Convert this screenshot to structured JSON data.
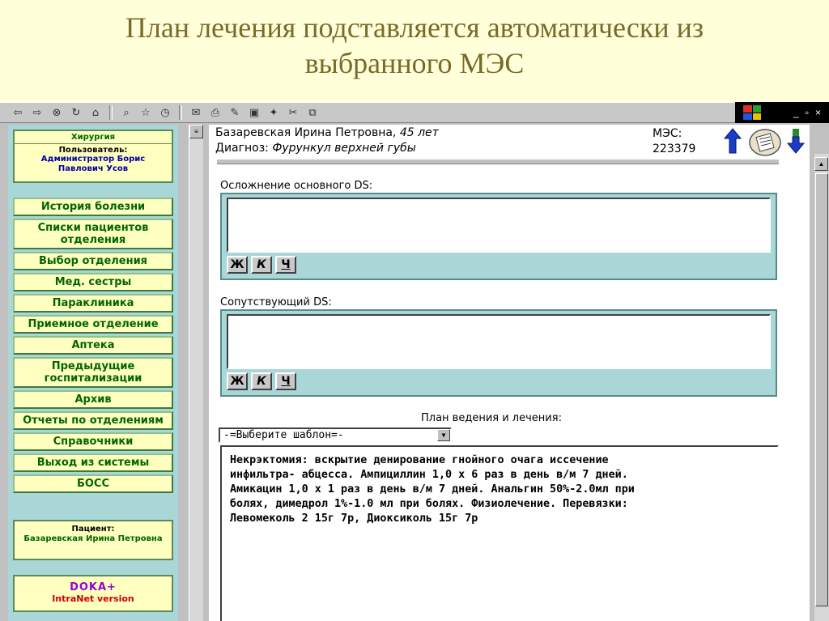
{
  "slide": {
    "title_line1": "План лечения подставляется автоматически из",
    "title_line2": "выбранного МЭС"
  },
  "toolbar": {
    "icons": [
      "back-icon",
      "forward-icon",
      "stop-icon",
      "refresh-icon",
      "home-icon",
      "search-icon",
      "favorites-icon",
      "history-icon",
      "mail-icon",
      "print-icon",
      "edit-icon",
      "discuss-icon",
      "messenger-icon",
      "cut-icon",
      "copy-icon"
    ]
  },
  "window_controls": {
    "minimize": "_",
    "restore": "▫",
    "close": "×"
  },
  "sidebar": {
    "dept": "Хирургия",
    "user_label": "Пользователь:",
    "user_name": "Администратор Борис Павлович Усов",
    "nav": [
      "История болезни",
      "Списки пациентов отделения",
      "Выбор отделения",
      "Мед. сестры",
      "Параклиника",
      "Приемное отделение",
      "Аптека",
      "Предыдущие госпитализации",
      "Архив",
      "Отчеты по отделениям",
      "Справочники",
      "Выход из системы",
      "БОСС"
    ],
    "patient_label": "Пациент:",
    "patient_name": "Базаревская Ирина Петровна",
    "brand": "DOKA+",
    "brand_sub": "IntraNet version"
  },
  "header": {
    "patient_name": "Базаревская Ирина Петровна,",
    "patient_age": " 45 лет",
    "diagnosis_label": "Диагноз: ",
    "diagnosis": "Фурункул верхней губы",
    "mes_label": "МЭС:",
    "mes_value": "223379"
  },
  "complication": {
    "label": "Осложнение основного DS:",
    "value": "",
    "buttons": [
      "Ж",
      "К",
      "Ч"
    ]
  },
  "concomitant": {
    "label": "Сопутствующий DS:",
    "value": "",
    "buttons": [
      "Ж",
      "К",
      "Ч"
    ]
  },
  "plan": {
    "label": "План ведения и лечения:",
    "template_select": "-=Выберите шаблон=-",
    "text": "Некрэктомия: вскрытие денирование гнойного очага иссечение\nинфильтра- абцесса. Ампициллин 1,0 х 6 раз в день в/м 7 дней.\nАмикацин 1,0 х 1 раз в день в/м 7 дней. Анальгин 50%-2.0мл при\nболях, димедрол 1%-1.0 мл при болях. Физиолечение. Перевязки:\nЛевомеколь 2 15г 7р, Диоксиколь 15г 7р"
  },
  "colors": {
    "sidebar_bg": "#a9d6d6",
    "nav_text": "#006600",
    "title_text": "#7a6a2a",
    "arrow_blue": "#1a3cc8",
    "arrow_green": "#2a8a2a"
  }
}
